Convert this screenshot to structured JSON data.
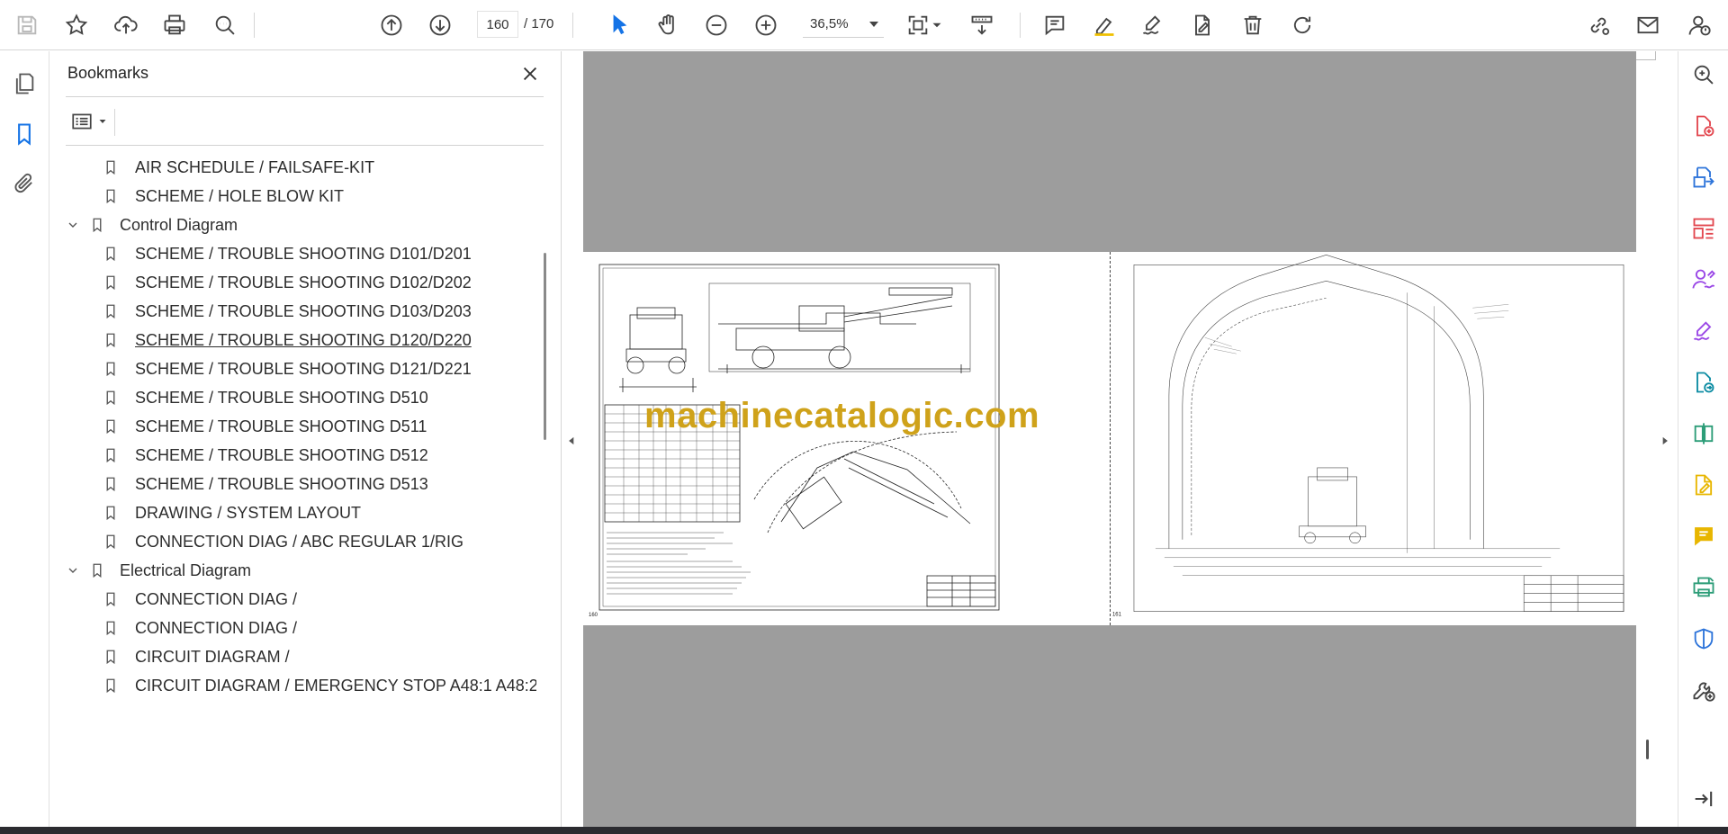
{
  "toolbar": {
    "page_current": "160",
    "page_total": "/ 170",
    "zoom": "36,5%"
  },
  "bookmarks": {
    "title": "Bookmarks",
    "items": [
      {
        "label": "AIR SCHEDULE / FAILSAFE-KIT",
        "level": 1
      },
      {
        "label": "SCHEME / HOLE BLOW KIT",
        "level": 1
      },
      {
        "label": "Control Diagram",
        "level": 0,
        "expanded": true
      },
      {
        "label": "SCHEME / TROUBLE SHOOTING D101/D201",
        "level": 1
      },
      {
        "label": "SCHEME / TROUBLE SHOOTING D102/D202",
        "level": 1
      },
      {
        "label": "SCHEME / TROUBLE SHOOTING D103/D203",
        "level": 1
      },
      {
        "label": "SCHEME / TROUBLE SHOOTING D120/D220",
        "level": 1,
        "hover": true
      },
      {
        "label": "SCHEME / TROUBLE SHOOTING D121/D221",
        "level": 1
      },
      {
        "label": "SCHEME / TROUBLE SHOOTING D510",
        "level": 1
      },
      {
        "label": "SCHEME / TROUBLE SHOOTING D511",
        "level": 1
      },
      {
        "label": "SCHEME / TROUBLE SHOOTING D512",
        "level": 1
      },
      {
        "label": "SCHEME / TROUBLE SHOOTING D513",
        "level": 1
      },
      {
        "label": "DRAWING / SYSTEM LAYOUT",
        "level": 1
      },
      {
        "label": "CONNECTION DIAG / ABC REGULAR 1/RIG",
        "level": 1
      },
      {
        "label": "Electrical Diagram",
        "level": 0,
        "expanded": true
      },
      {
        "label": "CONNECTION DIAG /",
        "level": 1
      },
      {
        "label": "CONNECTION DIAG /",
        "level": 1
      },
      {
        "label": "CIRCUIT DIAGRAM /",
        "level": 1
      },
      {
        "label": "CIRCUIT DIAGRAM / EMERGENCY STOP A48:1 A48:2",
        "level": 1
      }
    ]
  },
  "document": {
    "watermark": "machinecatalogic.com",
    "page_left_number": "160",
    "page_right_number": "161"
  },
  "colors": {
    "accent": "#1473e6",
    "watermark": "#cfa21a",
    "viewer_gray": "#9d9d9d",
    "tool_red": "#e34850",
    "tool_blue": "#2d74da",
    "tool_purple": "#9a47e6",
    "tool_green": "#2d9d78",
    "tool_yellow": "#e8b600",
    "tool_teal": "#0d8ca3"
  },
  "icons": {
    "toolbar": [
      "save-icon",
      "star-icon",
      "upload-icon",
      "print-icon",
      "find-icon",
      "prev-page-icon",
      "next-page-icon",
      "select-arrow-icon",
      "hand-icon",
      "zoom-out-icon",
      "zoom-in-icon",
      "fit-page-icon",
      "scroll-mode-icon",
      "comment-icon",
      "highlight-icon",
      "sign-icon",
      "edit-fill-icon",
      "delete-icon",
      "rotate-icon",
      "share-link-icon",
      "email-icon",
      "account-help-icon"
    ],
    "left_rail": [
      "page-thumbnails-icon",
      "bookmarks-icon",
      "attachments-icon"
    ],
    "right_rail": [
      "zoom-search-icon",
      "create-pdf-icon",
      "export-pdf-icon",
      "organize-pages-icon",
      "request-sign-icon",
      "fill-sign-icon",
      "convert-pdf-icon",
      "compare-icon",
      "edit-pdf-icon",
      "comment-tool-icon",
      "print-production-icon",
      "protect-icon",
      "more-tools-icon",
      "expand-panel-icon"
    ]
  }
}
